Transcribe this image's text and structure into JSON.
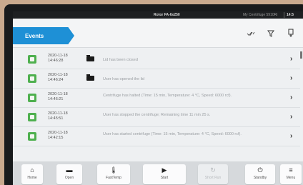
{
  "status_bar": {
    "title": "Rotor FA-6x250",
    "device": "My Centrifuge 5910Ri",
    "time": "14:5"
  },
  "header": {
    "tab_label": "Events",
    "icons": [
      "filter-check-icon",
      "filter-icon",
      "export-icon"
    ]
  },
  "events": [
    {
      "date": "2020-11-18",
      "time": "14:46:28",
      "icon": "folder-icon",
      "message": "Lid has been closed"
    },
    {
      "date": "2020-11-18",
      "time": "14:46:24",
      "icon": "folder-icon",
      "message": "User has opened the lid"
    },
    {
      "date": "2020-11-18",
      "time": "14:46:21",
      "icon": "",
      "message": "Centrifuge has halted (Time: 15 min, Temperature: 4 °C, Speed: 6000 rcf)."
    },
    {
      "date": "2020-11-18",
      "time": "14:45:51",
      "icon": "",
      "message": "User has stopped the centrifuge; Remaining time 11 min 25 s."
    },
    {
      "date": "2020-11-18",
      "time": "14:42:15",
      "icon": "",
      "message": "User has started centrifuge (Time: 15 min, Temperature: 4 °C, Speed: 6000 rcf)."
    }
  ],
  "bottom_bar": {
    "home": "Home",
    "open": "Open",
    "fasttemp": "FastTemp",
    "start": "Start",
    "short_run": "Short Run",
    "standby": "Standby",
    "menu": "Menu"
  },
  "colors": {
    "accent": "#1e90d6",
    "status_ok": "#4fb04f",
    "topbar": "#1e2022"
  }
}
